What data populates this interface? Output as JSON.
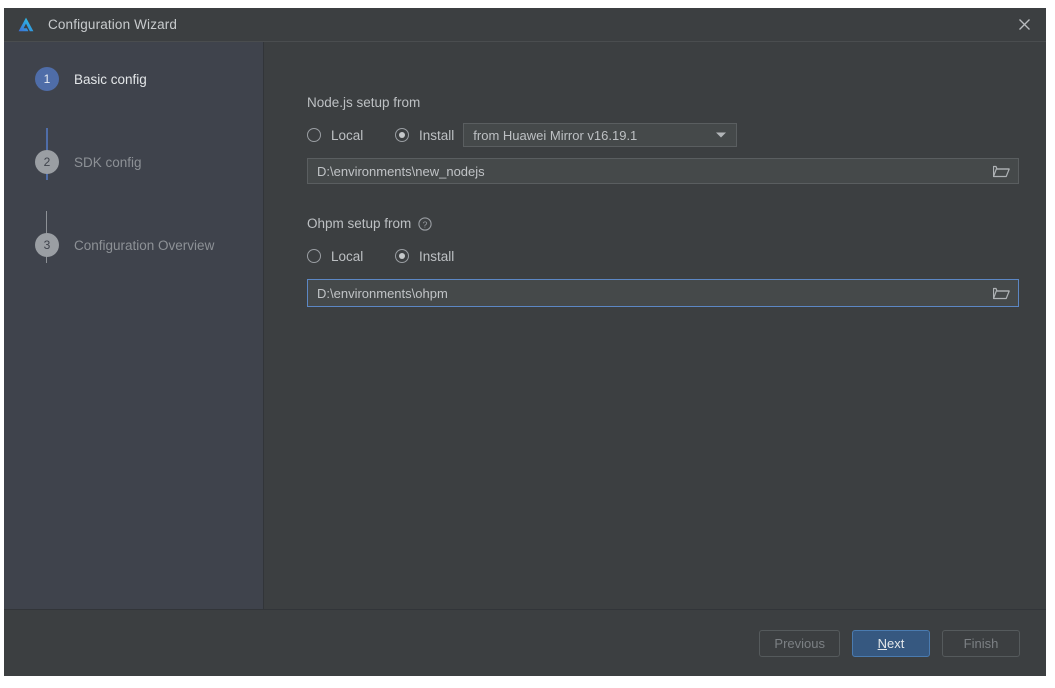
{
  "window": {
    "title": "Configuration Wizard",
    "logo_icon": "deveco-logo-icon",
    "close_icon": "close-icon"
  },
  "sidebar": {
    "steps": [
      {
        "number": "1",
        "label": "Basic config",
        "state": "active"
      },
      {
        "number": "2",
        "label": "SDK config",
        "state": "inactive"
      },
      {
        "number": "3",
        "label": "Configuration Overview",
        "state": "inactive"
      }
    ]
  },
  "content": {
    "nodejs": {
      "section_title": "Node.js setup from",
      "radio_local_label": "Local",
      "radio_install_label": "Install",
      "selected": "Install",
      "mirror_dropdown": {
        "value": "from Huawei Mirror v16.19.1",
        "arrow_icon": "chevron-down-icon"
      },
      "path": {
        "value": "D:\\environments\\new_nodejs",
        "placeholder": "",
        "browse_icon": "folder-icon",
        "focused": false
      }
    },
    "ohpm": {
      "section_title": "Ohpm setup from",
      "help_icon": "help-circle-icon",
      "radio_local_label": "Local",
      "radio_install_label": "Install",
      "selected": "Install",
      "path": {
        "value": "D:\\environments\\ohpm",
        "placeholder": "",
        "browse_icon": "folder-icon",
        "focused": true
      }
    }
  },
  "footer": {
    "previous_label": "Previous",
    "next_label_mnemonic": "N",
    "next_label_rest": "ext",
    "finish_label": "Finish"
  },
  "colors": {
    "window_bg": "#3c3f41",
    "sidebar_bg": "#3f434c",
    "accent_blue": "#4f6da8",
    "primary_button_bg": "#365880",
    "focus_border": "#5c87c4",
    "text_primary": "#bdc0c3",
    "text_muted": "#8d9196"
  }
}
